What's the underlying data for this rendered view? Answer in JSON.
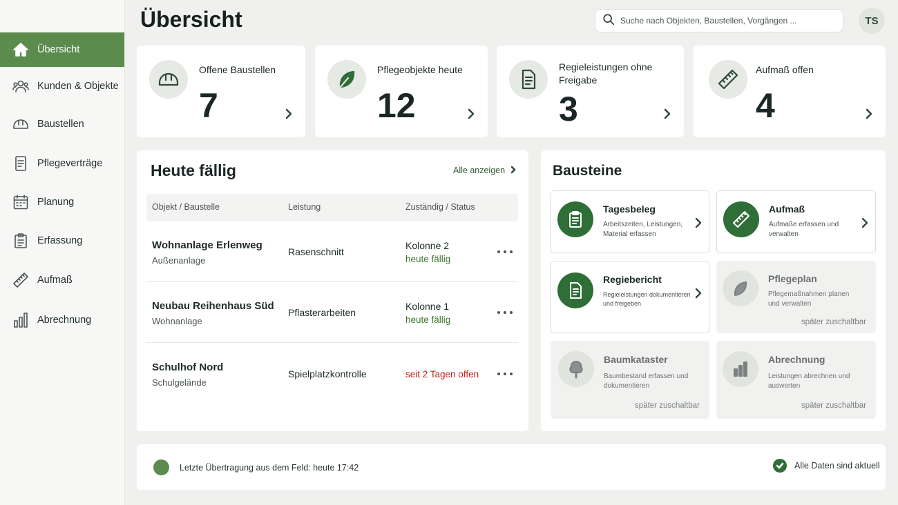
{
  "header": {
    "title": "Übersicht",
    "search_placeholder": "Suche nach Objekten, Baustellen, Vorgängen ...",
    "avatar_initials": "TS"
  },
  "sidebar": {
    "items": [
      {
        "label": "Übersicht",
        "icon": "home-icon",
        "active": true
      },
      {
        "label": "Kunden & Objekte",
        "icon": "users-icon"
      },
      {
        "label": "Baustellen",
        "icon": "hardhat-icon"
      },
      {
        "label": "Pflegeverträge",
        "icon": "document-icon"
      },
      {
        "label": "Planung",
        "icon": "calendar-icon"
      },
      {
        "label": "Erfassung",
        "icon": "clipboard-icon"
      },
      {
        "label": "Aufmaß",
        "icon": "ruler-icon"
      },
      {
        "label": "Abrechnung",
        "icon": "bar-chart-icon"
      }
    ]
  },
  "stats": [
    {
      "label": "Offene Baustellen",
      "value": "7",
      "icon": "hardhat-icon"
    },
    {
      "label": "Pflegeobjekte heute",
      "value": "12",
      "icon": "leaf-icon"
    },
    {
      "label": "Regieleistungen ohne Freigabe",
      "value": "3",
      "icon": "document-icon"
    },
    {
      "label": "Aufmaß offen",
      "value": "4",
      "icon": "ruler-icon"
    }
  ],
  "due": {
    "title": "Heute fällig",
    "show_all": "Alle anzeigen",
    "columns": [
      "Objekt / Baustelle",
      "Leistung",
      "Zuständig / Status"
    ],
    "rows": [
      {
        "object": "Wohnanlage Erlenweg",
        "sub": "Außenanlage",
        "service": "Rasenschnitt",
        "assignee": "Kolonne 2",
        "status": "heute fällig",
        "late": false
      },
      {
        "object": "Neubau Reihenhaus Süd",
        "sub": "Wohnanlage",
        "service": "Pflasterarbeiten",
        "assignee": "Kolonne 1",
        "status": "heute fällig",
        "late": false
      },
      {
        "object": "Schulhof Nord",
        "sub": "Schulgelände",
        "service": "Spielplatzkontrolle",
        "assignee": "",
        "status": "seit 2 Tagen offen",
        "late": true
      }
    ]
  },
  "blocks": {
    "title": "Bausteine",
    "later_label": "später zuschaltbar",
    "items": [
      {
        "title": "Tagesbeleg",
        "desc": "Arbeitszeiten, Leistungen, Material erfassen",
        "icon": "clipboard-icon",
        "enabled": true
      },
      {
        "title": "Aufmaß",
        "desc": "Aufmaße erfassen und verwalten",
        "icon": "ruler-icon",
        "enabled": true
      },
      {
        "title": "Regiebericht",
        "desc": "Regieleistungen dokumentieren und freigeben",
        "icon": "document-icon",
        "enabled": true
      },
      {
        "title": "Pflegeplan",
        "desc": "Pflegemaßnahmen planen und verwalten",
        "icon": "leaf-icon",
        "enabled": false
      },
      {
        "title": "Baumkataster",
        "desc": "Baumbestand erfassen und dokumentieren",
        "icon": "tree-icon",
        "enabled": false
      },
      {
        "title": "Abrechnung",
        "desc": "Leistungen abrechnen und auswerten",
        "icon": "bar-chart-icon",
        "enabled": false
      }
    ]
  },
  "footer": {
    "last_sync": "Letzte Übertragung aus dem Feld: heute 17:42",
    "status": "Alle Daten sind aktuell"
  },
  "colors": {
    "accent": "#5c8b4e",
    "dark_green": "#2f6e36",
    "late_red": "#c0201a"
  }
}
